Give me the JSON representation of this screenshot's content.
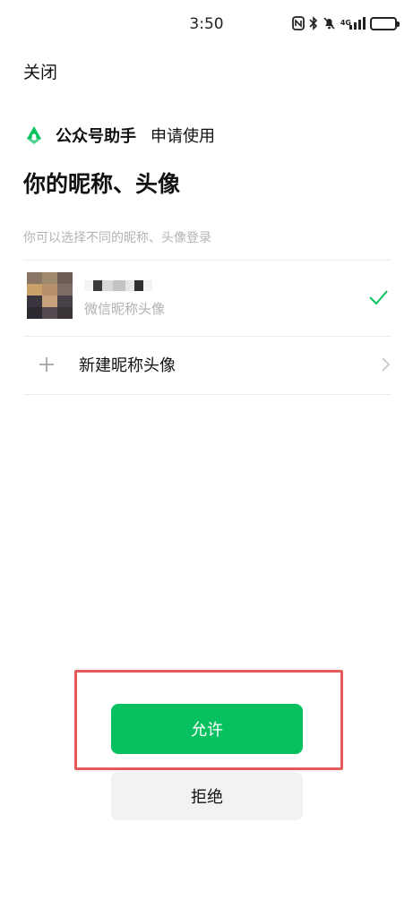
{
  "status_bar": {
    "time": "3:50",
    "network": "4G",
    "icons": [
      "nfc-icon",
      "bluetooth-icon",
      "mute-icon",
      "signal-icon",
      "battery-icon"
    ]
  },
  "header": {
    "close_label": "关闭"
  },
  "app": {
    "name": "公众号助手",
    "request_text": "申请使用",
    "brand_color": "#07c160"
  },
  "title": "你的昵称、头像",
  "hint": "你可以选择不同的昵称、头像登录",
  "options": {
    "wechat_profile_label": "微信昵称头像",
    "wechat_profile_selected": true,
    "new_profile_label": "新建昵称头像"
  },
  "actions": {
    "allow_label": "允许",
    "deny_label": "拒绝",
    "allow_color": "#07c160",
    "highlight_color": "#e45a5a"
  }
}
